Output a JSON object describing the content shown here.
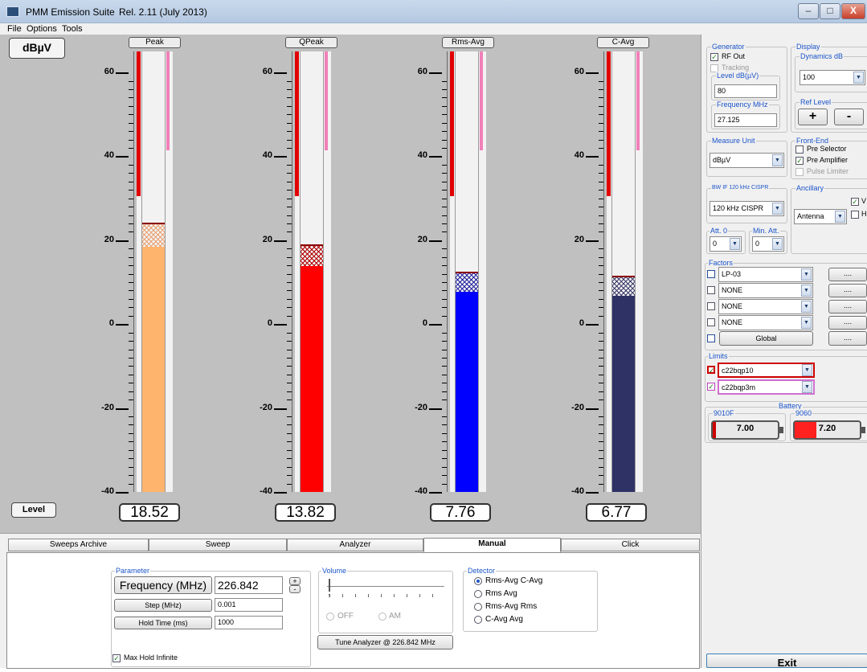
{
  "window": {
    "title": "PMM Emission Suite",
    "release": "Rel. 2.11 (July 2013)",
    "icon": "app-icon",
    "controls": {
      "minimize": "–",
      "maximize": "□",
      "close": "X"
    }
  },
  "menu": {
    "file": "File",
    "options": "Options",
    "tools": "Tools"
  },
  "meter": {
    "unit_label": "dBµV",
    "level_label": "Level",
    "axis_ticks": [
      "60",
      "40",
      "20",
      "0",
      "-20",
      "-40"
    ],
    "axis_range": [
      -40,
      65
    ],
    "channels": [
      {
        "name": "Peak",
        "value": "18.52",
        "level": 18.52,
        "peak": 23.8,
        "color": "#ffb46e",
        "hatch": "#e8a070"
      },
      {
        "name": "QPeak",
        "value": "13.82",
        "level": 13.82,
        "peak": 18.6,
        "color": "#ff0000",
        "hatch": "#b00000"
      },
      {
        "name": "Rms-Avg",
        "value": "7.76",
        "level": 7.76,
        "peak": 12.1,
        "color": "#0000ff",
        "hatch": "#2020a0"
      },
      {
        "name": "C-Avg",
        "value": "6.77",
        "level": 6.77,
        "peak": 11.2,
        "color": "#2e3264",
        "hatch": "#3a3a6a"
      }
    ],
    "limit_red_top": 30.5,
    "limit_pink_top": 41.5
  },
  "panel": {
    "generator": {
      "title": "Generator",
      "rf_out": "RF Out",
      "rf_out_checked": true,
      "tracking": "Tracking",
      "level_title": "Level dB(µV)",
      "level_value": "80",
      "freq_title": "Frequency MHz",
      "freq_value": "27.125"
    },
    "display": {
      "title": "Display",
      "dynamics_title": "Dynamics dB",
      "dynamics_value": "100",
      "reflevel_title": "Ref Level",
      "plus": "+",
      "minus": "-"
    },
    "measure_unit": {
      "title": "Measure Unit",
      "value": "dBµV"
    },
    "frontend": {
      "title": "Front-End",
      "pre_selector": "Pre Selector",
      "pre_amplifier": "Pre Amplifier",
      "pulse_limiter": "Pulse Limiter"
    },
    "bw": {
      "title": "BW IF 120 kHz CISPR",
      "value": "120 kHz CISPR"
    },
    "ancillary": {
      "title": "Ancillary",
      "value": "Antenna",
      "v": "V",
      "h": "H"
    },
    "att": {
      "title": "Att. 0",
      "value": "0"
    },
    "min_att": {
      "title": "Min. Att.",
      "value": "0"
    },
    "factors": {
      "title": "Factors",
      "items": [
        "LP-03",
        "NONE",
        "NONE",
        "NONE"
      ],
      "global": "Global",
      "dots": "...."
    },
    "limits": {
      "title": "Limits",
      "items": [
        "c22bqp10",
        "c22bqp3m"
      ]
    },
    "battery": {
      "title": "Battery",
      "units": [
        {
          "name": "9010F",
          "value": "7.00",
          "level": 0.05,
          "color": "#cc0000"
        },
        {
          "name": "9060",
          "value": "7.20",
          "level": 0.33,
          "color": "#ff2020"
        }
      ]
    },
    "exit": "Exit"
  },
  "tabs": {
    "items": [
      "Sweeps Archive",
      "Sweep",
      "Analyzer",
      "Manual",
      "Click"
    ],
    "active": "Manual"
  },
  "manual": {
    "parameter": {
      "title": "Parameter",
      "frequency_label": "Frequency (MHz)",
      "frequency_value": "226.842",
      "step_label": "Step (MHz)",
      "step_value": "0.001",
      "hold_label": "Hold Time (ms)",
      "hold_value": "1000",
      "plus": "+",
      "minus": "-"
    },
    "max_hold": "Max Hold Infinite",
    "volume": {
      "title": "Volume",
      "off": "OFF",
      "am": "AM"
    },
    "tune": "Tune Analyzer @ 226.842 MHz",
    "detector": {
      "title": "Detector",
      "options": [
        "Rms-Avg  C-Avg",
        "Rms  Avg",
        "Rms-Avg  Rms",
        "C-Avg  Avg"
      ]
    }
  }
}
